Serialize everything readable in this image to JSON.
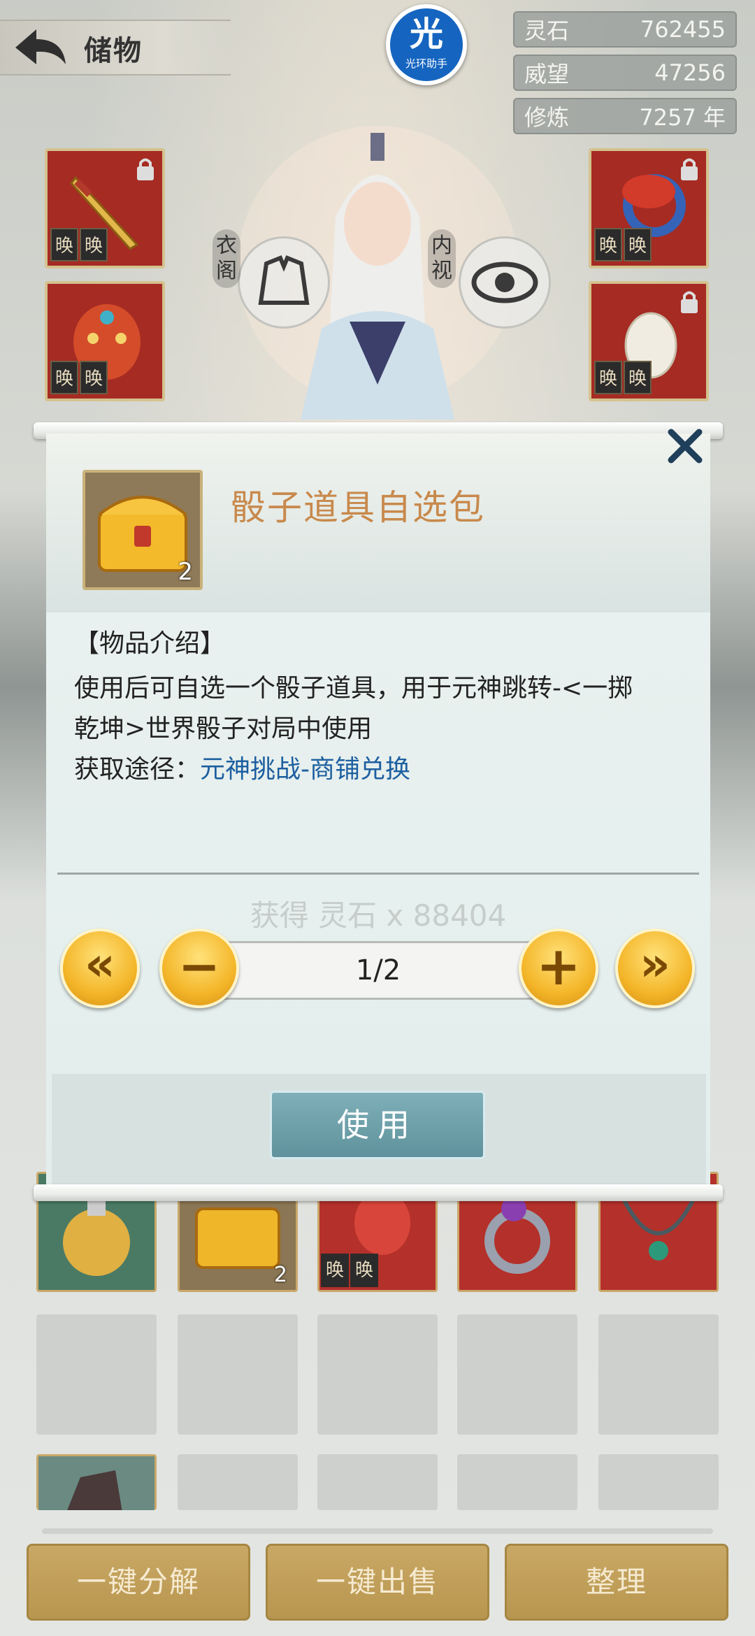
{
  "header": {
    "title": "储物",
    "helper": {
      "big": "光",
      "small": "光环助手"
    }
  },
  "stats": [
    {
      "label": "灵石",
      "value": "762455"
    },
    {
      "label": "威望",
      "value": "47256"
    },
    {
      "label": "修炼",
      "value": "7257 年"
    }
  ],
  "character": {
    "outfit_label": "衣阁",
    "inner_view_label": "内视"
  },
  "equipment": {
    "weapon_seals": [
      "㬇",
      "㬇"
    ],
    "helm_seals": [
      "㬇",
      "㬇"
    ],
    "ring_seals": [
      "㬇",
      "㬇"
    ],
    "charm_seals": [
      "㬇",
      "㬇"
    ]
  },
  "bag": {
    "chest_count": "2",
    "bracer_seals": [
      "㬇",
      "㬇"
    ]
  },
  "modal": {
    "item_name": "骰子道具自选包",
    "item_count": "2",
    "section_title": "【物品介绍】",
    "desc_line1": "使用后可自选一个骰子道具，用于元神跳转-<一掷",
    "desc_line2": "乾坤>世界骰子对局中使用",
    "source_label": "获取途径：",
    "source_link": "元神挑战-商铺兑换",
    "gain_text": "获得 灵石 x 88404",
    "page_indicator": "1/2",
    "first_symbol": "«",
    "minus_symbol": "−",
    "plus_symbol": "+",
    "last_symbol": "»",
    "use_label": "使用"
  },
  "bottom": {
    "decompose_label": "一键分解",
    "sell_label": "一键出售",
    "sort_label": "整理"
  },
  "colors": {
    "item_name": "#c8894c",
    "link": "#1d5fa0",
    "use_button": "#6fa2ab",
    "gold_button": "#f4b62a"
  }
}
